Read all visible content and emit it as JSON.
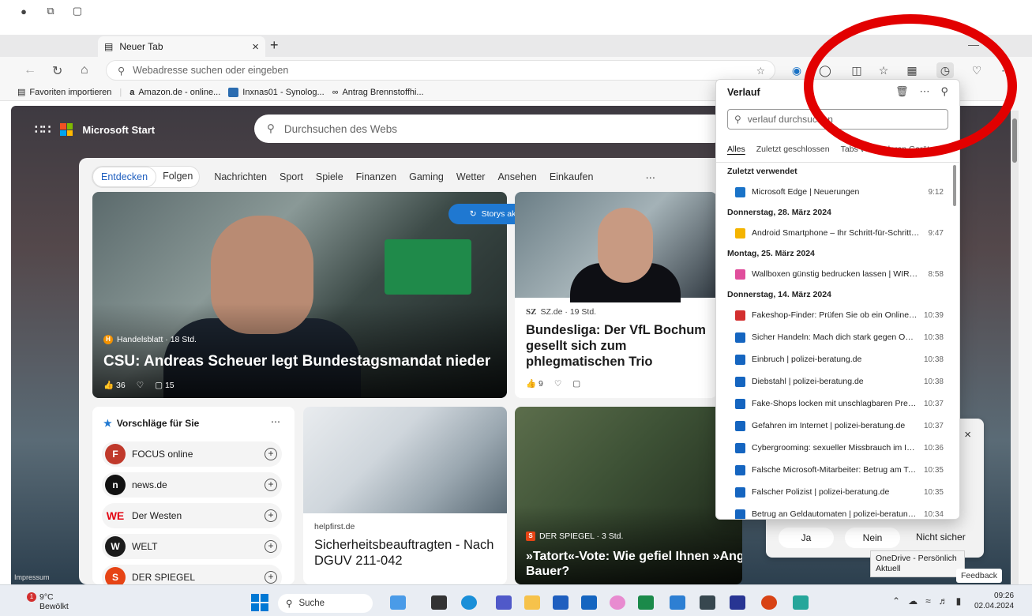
{
  "browser": {
    "tab_title": "Neuer Tab",
    "address_placeholder": "Webadresse suchen oder eingeben",
    "favorites": [
      {
        "label": "Favoriten importieren"
      },
      {
        "label": "Amazon.de - online..."
      },
      {
        "label": "Inxnas01 - Synolog..."
      },
      {
        "label": "Antrag Brennstoffhi..."
      }
    ]
  },
  "start": {
    "brand": "Microsoft Start",
    "search_placeholder": "Durchsuchen des Webs",
    "tabs": [
      "Entdecken",
      "Folgen",
      "Nachrichten",
      "Sport",
      "Spiele",
      "Finanzen",
      "Gaming",
      "Wetter",
      "Ansehen",
      "Einkaufen"
    ],
    "refresh_label": "Storys aktualisieren",
    "hero": {
      "source": "Handelsblatt · 18 Std.",
      "headline": "CSU: Andreas Scheuer legt Bundestagsmandat nieder",
      "likes": "36",
      "comments": "15"
    },
    "card2": {
      "source": "SZ.de · 19 Std.",
      "source_logo": "SZ",
      "headline": "Bundesliga: Der VfL Bochum gesellt sich zum phlegmatischen Trio",
      "likes": "9"
    },
    "suggestions": {
      "title": "Vorschläge für Sie",
      "items": [
        {
          "name": "FOCUS online",
          "color": "#c0392b",
          "glyph": "F"
        },
        {
          "name": "news.de",
          "color": "#111111",
          "glyph": "n"
        },
        {
          "name": "Der Westen",
          "color": "#ffffff",
          "glyph": "WE"
        },
        {
          "name": "WELT",
          "color": "#1b1b1b",
          "glyph": "W"
        },
        {
          "name": "DER SPIEGEL",
          "color": "#e64415",
          "glyph": "S"
        }
      ]
    },
    "card3": {
      "source": "helpfirst.de",
      "headline": "Sicherheitsbeauftragten - Nach DGUV 211-042"
    },
    "card4": {
      "source": "DER SPIEGEL · 3 Std.",
      "headline": "»Tatort«-Vote: Wie gefiel Ihnen »Angst im Dunkeln« mit Jasna Fritzi Bauer?"
    },
    "impressum": "Impressum",
    "survey": {
      "yes": "Ja",
      "no": "Nein",
      "unsure": "Nicht sicher"
    },
    "feedback": "Feedback",
    "onedrive_tip": {
      "line1": "OneDrive - Persönlich",
      "line2": "Aktuell"
    }
  },
  "history": {
    "title": "Verlauf",
    "search_placeholder": "verlauf durchsuchen",
    "filters": [
      "Alles",
      "Zuletzt geschlossen",
      "Tabs von anderen Geräten"
    ],
    "groups": [
      {
        "label": "Zuletzt verwendet",
        "items": [
          {
            "title": "Microsoft Edge | Neuerungen",
            "time": "9:12",
            "icon": "#1a73c8"
          }
        ]
      },
      {
        "label": "Donnerstag, 28. März 2024",
        "items": [
          {
            "title": "Android Smartphone – Ihr Schritt-für-Schritt-...",
            "time": "9:47",
            "icon": "#f4b400"
          }
        ]
      },
      {
        "label": "Montag, 25. März 2024",
        "items": [
          {
            "title": "Wallboxen günstig bedrucken lassen | WIRma...",
            "time": "8:58",
            "icon": "#e04e9c"
          }
        ]
      },
      {
        "label": "Donnerstag, 14. März 2024",
        "items": [
          {
            "title": "Fakeshop-Finder: Prüfen Sie ob ein Online-S...",
            "time": "10:39",
            "icon": "#d32f2f"
          },
          {
            "title": "Sicher Handeln: Mach dich stark gegen Onli...",
            "time": "10:38",
            "icon": "#1565c0"
          },
          {
            "title": "Einbruch | polizei-beratung.de",
            "time": "10:38",
            "icon": "#1565c0"
          },
          {
            "title": "Diebstahl | polizei-beratung.de",
            "time": "10:38",
            "icon": "#1565c0"
          },
          {
            "title": "Fake-Shops locken mit unschlagbaren Preise...",
            "time": "10:37",
            "icon": "#1565c0"
          },
          {
            "title": "Gefahren im Internet | polizei-beratung.de",
            "time": "10:37",
            "icon": "#1565c0"
          },
          {
            "title": "Cybergrooming: sexueller Missbrauch im Int...",
            "time": "10:36",
            "icon": "#1565c0"
          },
          {
            "title": "Falsche Microsoft-Mitarbeiter: Betrug am Tel...",
            "time": "10:35",
            "icon": "#1565c0"
          },
          {
            "title": "Falscher Polizist | polizei-beratung.de",
            "time": "10:35",
            "icon": "#1565c0"
          },
          {
            "title": "Betrug an Geldautomaten | polizei-beratung...",
            "time": "10:34",
            "icon": "#1565c0"
          }
        ]
      }
    ]
  },
  "taskbar": {
    "weather_temp": "9°C",
    "weather_desc": "Bewölkt",
    "weather_badge": "1",
    "search": "Suche",
    "time": "09:26",
    "date": "02.04.2024"
  },
  "colors": {
    "accent": "#1f78d1",
    "annotation": "#e20000"
  }
}
